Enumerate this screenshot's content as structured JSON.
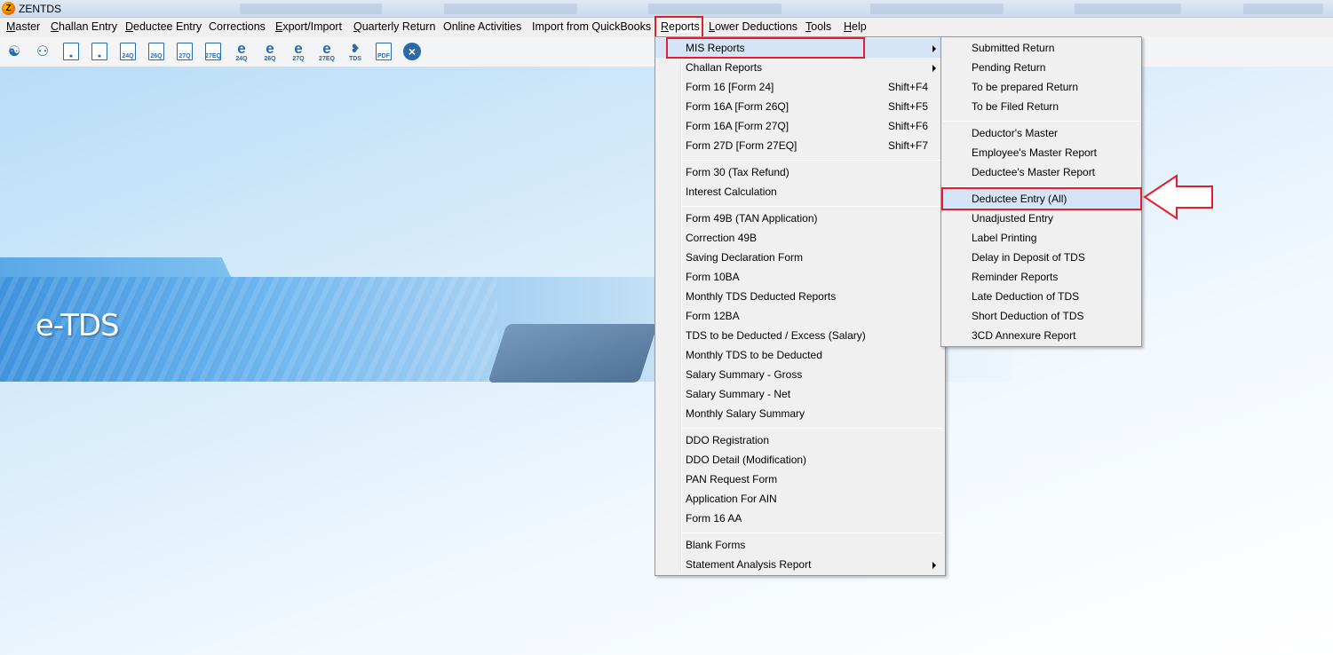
{
  "window": {
    "title": "ZENTDS"
  },
  "menubar": [
    "Master",
    "Challan Entry",
    "Deductee Entry",
    "Corrections",
    "Export/Import",
    "Quarterly Return",
    "Online Activities",
    "Import from QuickBooks",
    "Reports",
    "Lower Deductions",
    "Tools",
    "Help"
  ],
  "toolbar": {
    "icons": [
      "users-icon",
      "group-icon",
      "person-doc-icon",
      "person-doc-icon",
      "form-24q-icon",
      "form-26q-icon",
      "form-27q-icon",
      "form-27eq-icon",
      "e-24q-icon",
      "e-26q-icon",
      "e-27q-icon",
      "e-27eq-icon",
      "tds-icon",
      "pdf-icon",
      "close-icon"
    ],
    "labels": [
      "24Q",
      "26Q",
      "27Q",
      "27EQ",
      "24Q",
      "26Q",
      "27Q",
      "27EQ",
      "TDS",
      "PDF"
    ]
  },
  "banner": {
    "text": "e-TDS"
  },
  "reports_menu": [
    {
      "label": "MIS Reports",
      "submenu": true
    },
    {
      "label": "Challan Reports",
      "submenu": true
    },
    {
      "label": "Form 16 [Form 24]",
      "shortcut": "Shift+F4"
    },
    {
      "label": "Form 16A [Form 26Q]",
      "shortcut": "Shift+F5"
    },
    {
      "label": "Form 16A [Form 27Q]",
      "shortcut": "Shift+F6"
    },
    {
      "label": "Form 27D [Form 27EQ]",
      "shortcut": "Shift+F7"
    },
    {
      "label": "Form 30 (Tax Refund)"
    },
    {
      "label": "Interest Calculation"
    },
    {
      "label": "Form 49B (TAN Application)"
    },
    {
      "label": "Correction 49B"
    },
    {
      "label": "Saving Declaration Form"
    },
    {
      "label": "Form 10BA"
    },
    {
      "label": "Monthly TDS Deducted Reports"
    },
    {
      "label": "Form 12BA"
    },
    {
      "label": "TDS to be Deducted / Excess  (Salary)"
    },
    {
      "label": "Monthly TDS to be Deducted"
    },
    {
      "label": "Salary Summary - Gross"
    },
    {
      "label": "Salary Summary - Net"
    },
    {
      "label": "Monthly Salary Summary"
    },
    {
      "label": "DDO Registration"
    },
    {
      "label": "DDO Detail (Modification)"
    },
    {
      "label": "PAN Request Form"
    },
    {
      "label": "Application For AIN"
    },
    {
      "label": "Form 16 AA"
    },
    {
      "label": "Blank Forms"
    },
    {
      "label": "Statement Analysis Report",
      "submenu": true
    }
  ],
  "mis_menu": [
    "Submitted Return",
    "Pending Return",
    "To be prepared Return",
    "To be Filed Return",
    "Deductor's Master",
    "Employee's Master Report",
    "Deductee's Master Report",
    "Deductee Entry (All)",
    "Unadjusted Entry",
    "Label Printing",
    "Delay in Deposit of TDS",
    "Reminder Reports",
    "Late Deduction of TDS",
    "Short Deduction of TDS",
    "3CD Annexure Report"
  ],
  "colors": {
    "highlight": "#e0202a",
    "menu_bg": "#f0f0f0",
    "accent": "#2b6aa8"
  }
}
